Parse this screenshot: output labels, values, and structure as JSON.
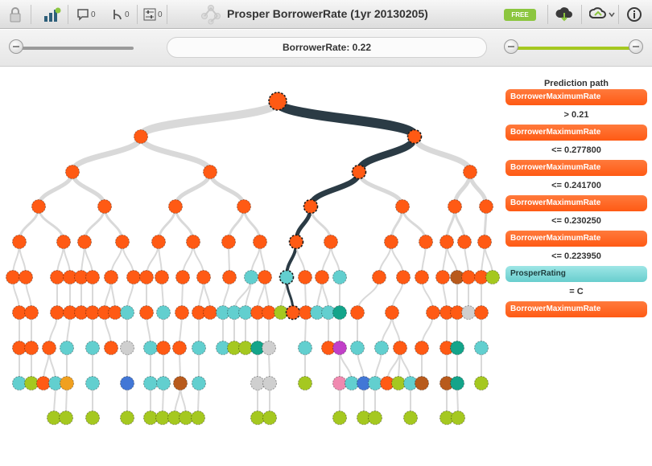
{
  "toolbar": {
    "title": "Prosper BorrowerRate (1yr 20130205)",
    "comments_count": "0",
    "forks_count": "0",
    "settings_count": "0",
    "badge": "FREE"
  },
  "slider": {
    "label": "BorrowerRate: 0.22"
  },
  "prediction_path": {
    "title": "Prediction path",
    "steps": [
      {
        "field": "BorrowerMaximumRate",
        "condition": "> 0.21"
      },
      {
        "field": "BorrowerMaximumRate",
        "condition": "<= 0.277800"
      },
      {
        "field": "BorrowerMaximumRate",
        "condition": "<= 0.241700"
      },
      {
        "field": "BorrowerMaximumRate",
        "condition": "<= 0.230250"
      },
      {
        "field": "BorrowerMaximumRate",
        "condition": "<= 0.223950"
      },
      {
        "field": "ProsperRating",
        "condition": "= C"
      },
      {
        "field": "BorrowerMaximumRate",
        "condition": ""
      }
    ]
  },
  "colors": {
    "orange": "#ff5a14",
    "teal": "#62cfcf",
    "lime": "#a5c820",
    "gray": "#cfcfcf",
    "blue": "#4277d6",
    "yellow": "#f0a020",
    "brown": "#b85a1c",
    "green": "#13a48a",
    "purple": "#c13fc8",
    "pink": "#f08ab0",
    "dark": "#1e2a32",
    "path_highlight": "#2b3b45",
    "link": "#d9d9d9"
  }
}
